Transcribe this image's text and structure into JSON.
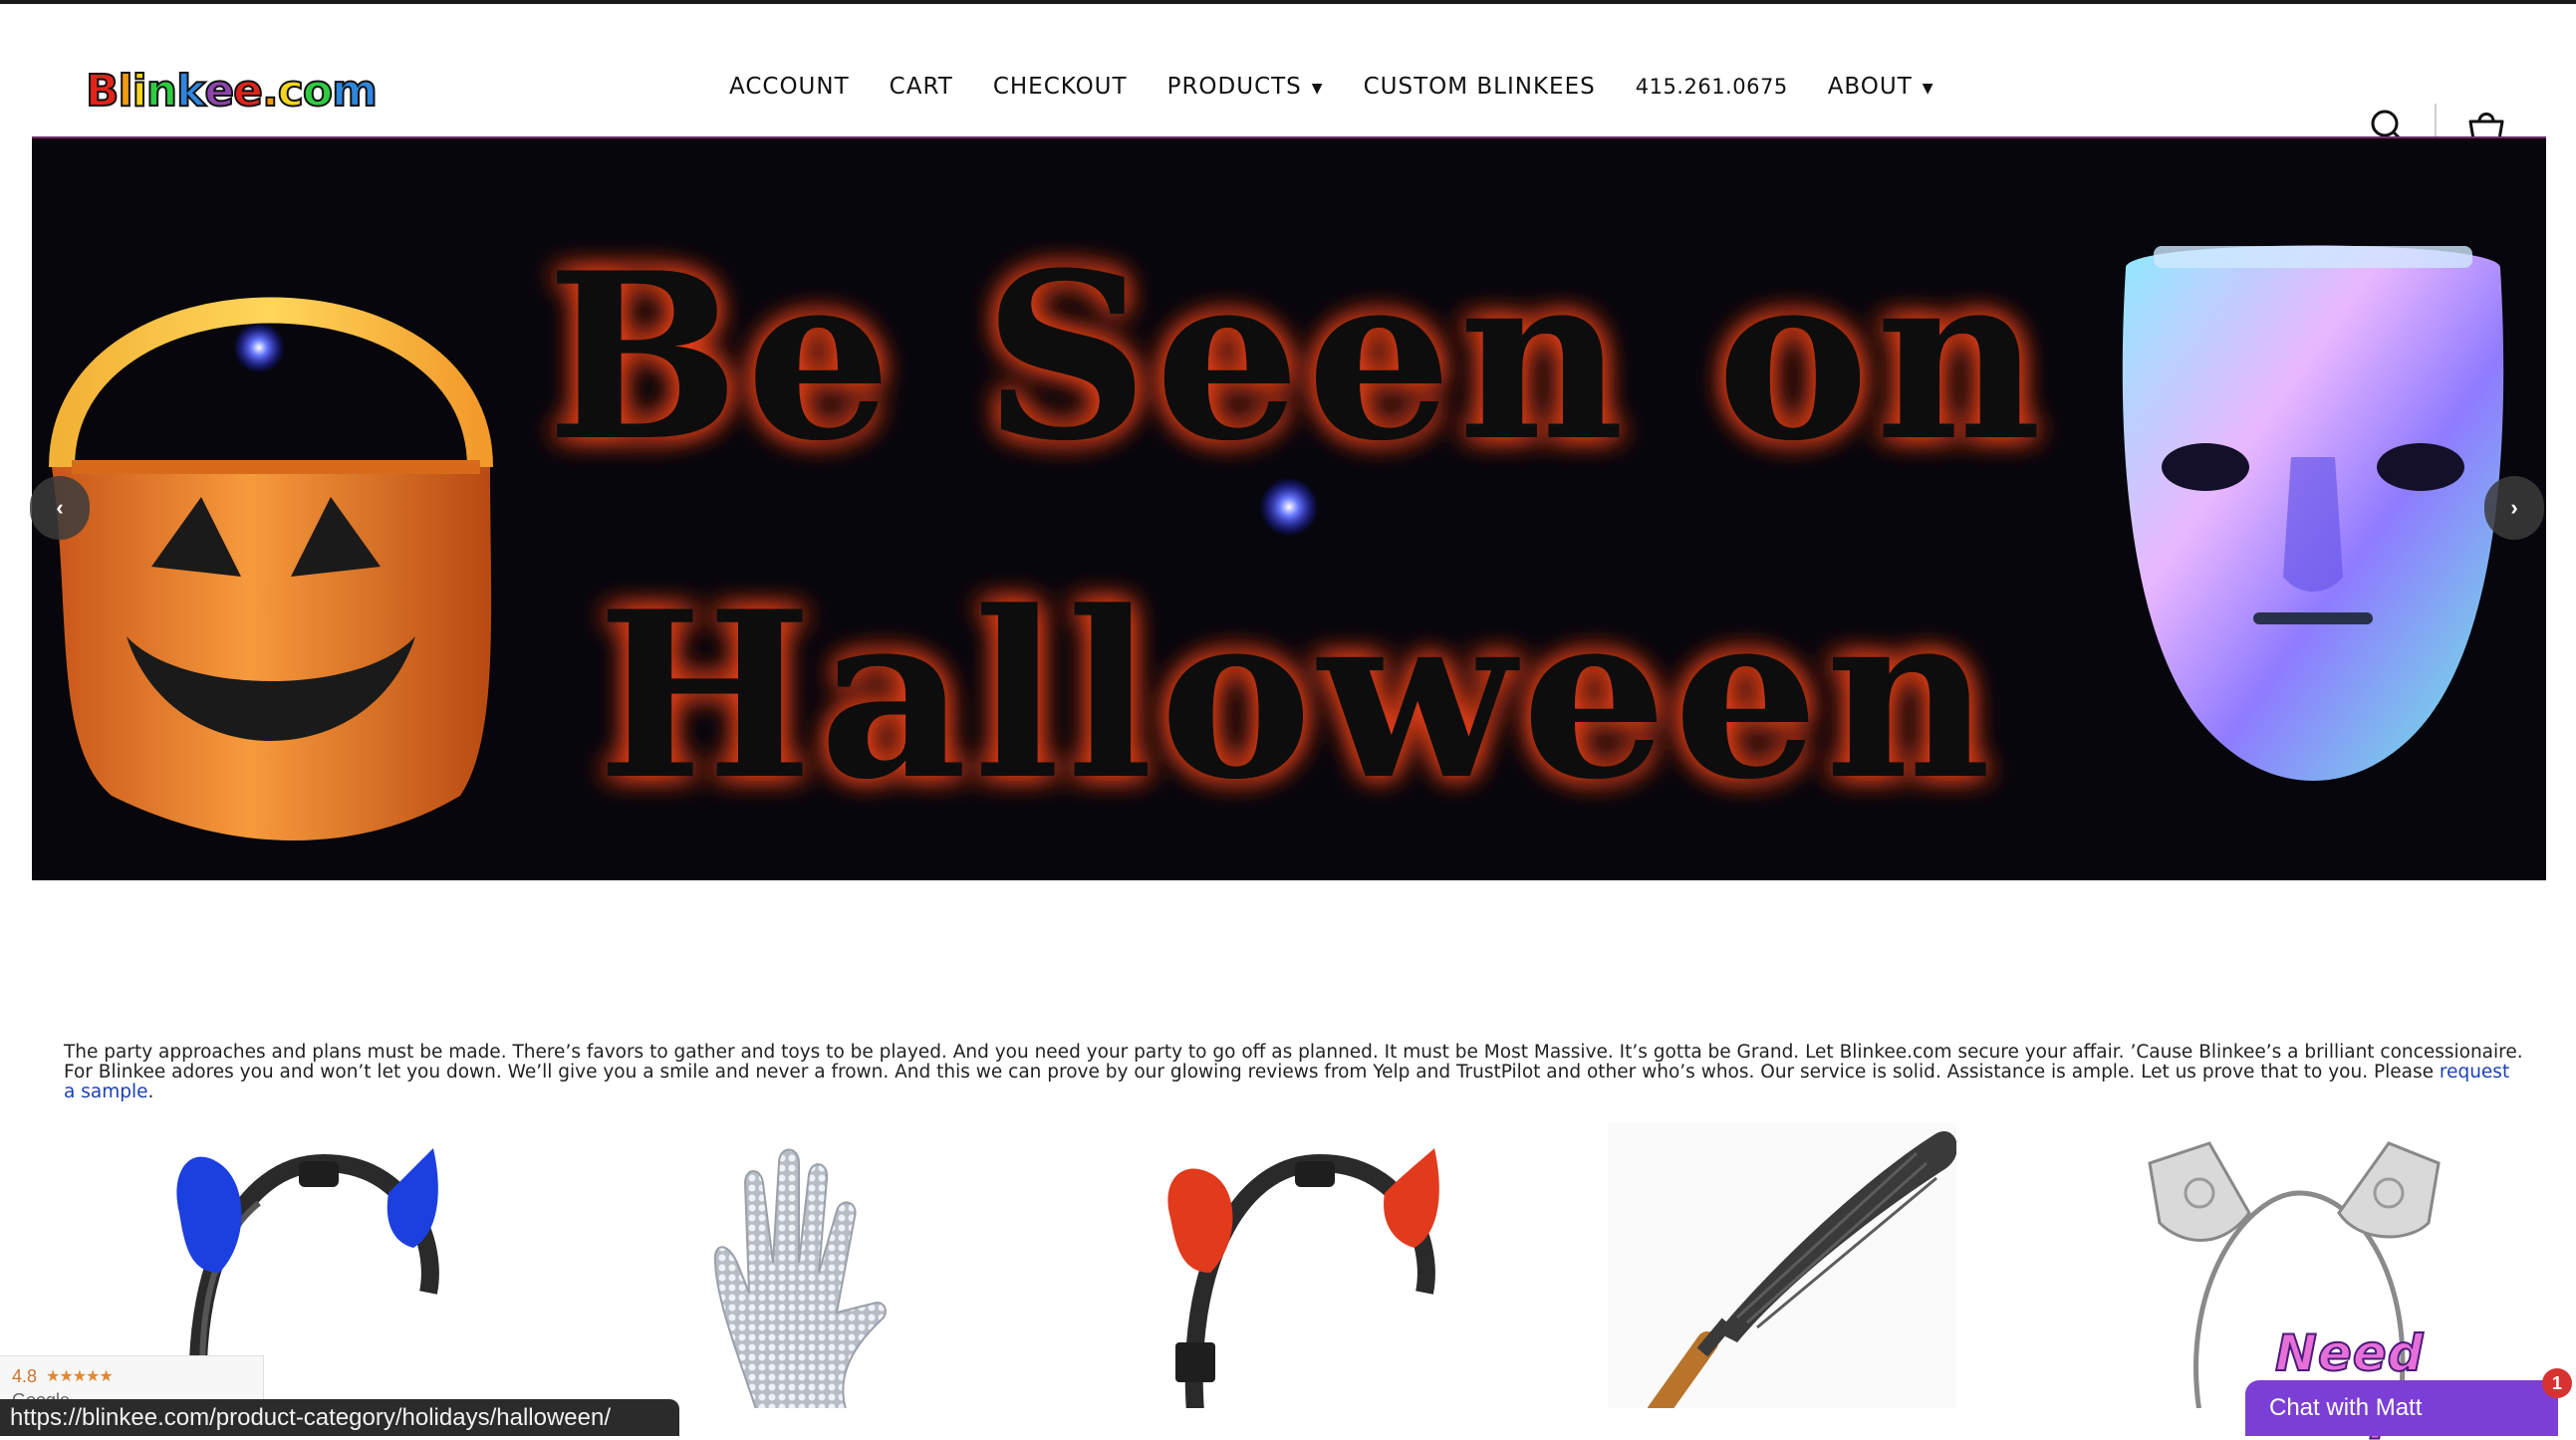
{
  "header": {
    "logo_text": "Blinkee.com",
    "logo_colors": [
      "#e2231a",
      "#f39c12",
      "#f7d51d",
      "#2ecc40",
      "#2e86de",
      "#8e44ad"
    ],
    "nav": [
      {
        "label": "ACCOUNT",
        "has_dropdown": false
      },
      {
        "label": "CART",
        "has_dropdown": false
      },
      {
        "label": "CHECKOUT",
        "has_dropdown": false
      },
      {
        "label": "PRODUCTS",
        "has_dropdown": true
      },
      {
        "label": "CUSTOM BLINKEES",
        "has_dropdown": false
      },
      {
        "label": "415.261.0675",
        "has_dropdown": false
      },
      {
        "label": "ABOUT",
        "has_dropdown": true
      }
    ],
    "icons": [
      "search-icon",
      "shopping-bag-icon"
    ]
  },
  "banner": {
    "line1": "Be Seen on",
    "line2": "Halloween",
    "text_glow_color": "#e8401c",
    "prev_arrow": "‹",
    "next_arrow": "›"
  },
  "intro": {
    "text": "The party approaches and plans must be made. There’s favors to gather and toys to be played. And you need your party to go off as planned. It must be Most Massive. It’s gotta be Grand. Let Blinkee.com secure your affair. ’Cause Blinkee’s a brilliant concessionaire. For Blinkee adores you and won’t let you down. We’ll give you a smile and never a frown. And this we can prove by our glowing reviews from Yelp and TrustPilot and other who’s whos. Our service is solid. Assistance is ample. Let us prove that to you. Please ",
    "link_text": "request a sample",
    "suffix": "."
  },
  "products": [
    {
      "name": "blue-devil-horns-headband",
      "accent": "#1c3fe0"
    },
    {
      "name": "silver-sequin-glove",
      "accent": "#c8c8c8"
    },
    {
      "name": "red-devil-horns-headband",
      "accent": "#e23a1c"
    },
    {
      "name": "witch-broom",
      "accent": "#b8742a"
    },
    {
      "name": "silver-lace-cat-ears-headband",
      "accent": "#bdbdbd"
    }
  ],
  "rating_widget": {
    "score": "4.8",
    "stars": "★★★★★",
    "brand": "Google"
  },
  "status_url": "https://blinkee.com/product-category/holidays/halloween/",
  "chat": {
    "title": "Need Help?",
    "button_label": "Chat with Matt",
    "badge_count": "1"
  }
}
